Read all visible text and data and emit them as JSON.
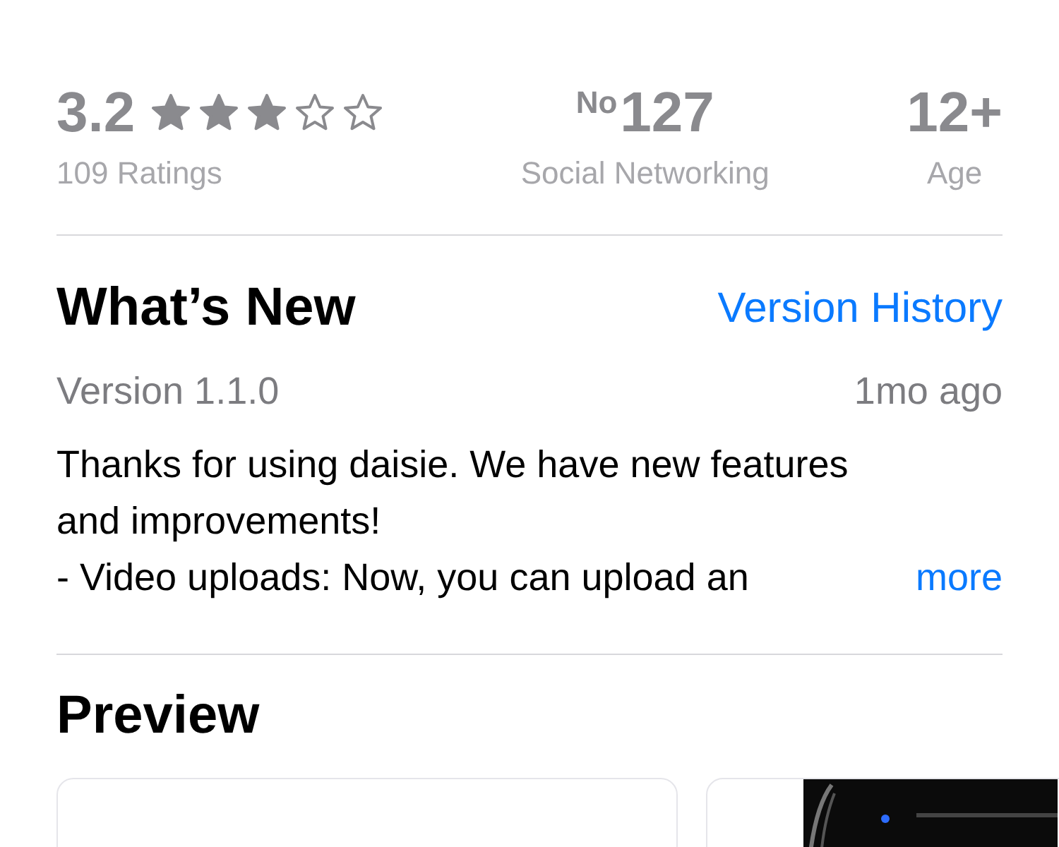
{
  "stats": {
    "rating": {
      "value": "3.2",
      "stars": 3,
      "caption": "109 Ratings"
    },
    "rank": {
      "prefix": "No",
      "number": "127",
      "caption": "Social Networking"
    },
    "age": {
      "value": "12+",
      "caption": "Age"
    }
  },
  "whats_new": {
    "title": "What’s New",
    "link": "Version History",
    "version": "Version 1.1.0",
    "date": "1mo ago",
    "lines": [
      "Thanks for using daisie. We have new features",
      "and improvements!",
      "- Video uploads: Now, you can upload an"
    ],
    "more": "more"
  },
  "preview": {
    "title": "Preview",
    "cards": [
      {
        "kind": "blank"
      },
      {
        "kind": "picture"
      }
    ]
  }
}
